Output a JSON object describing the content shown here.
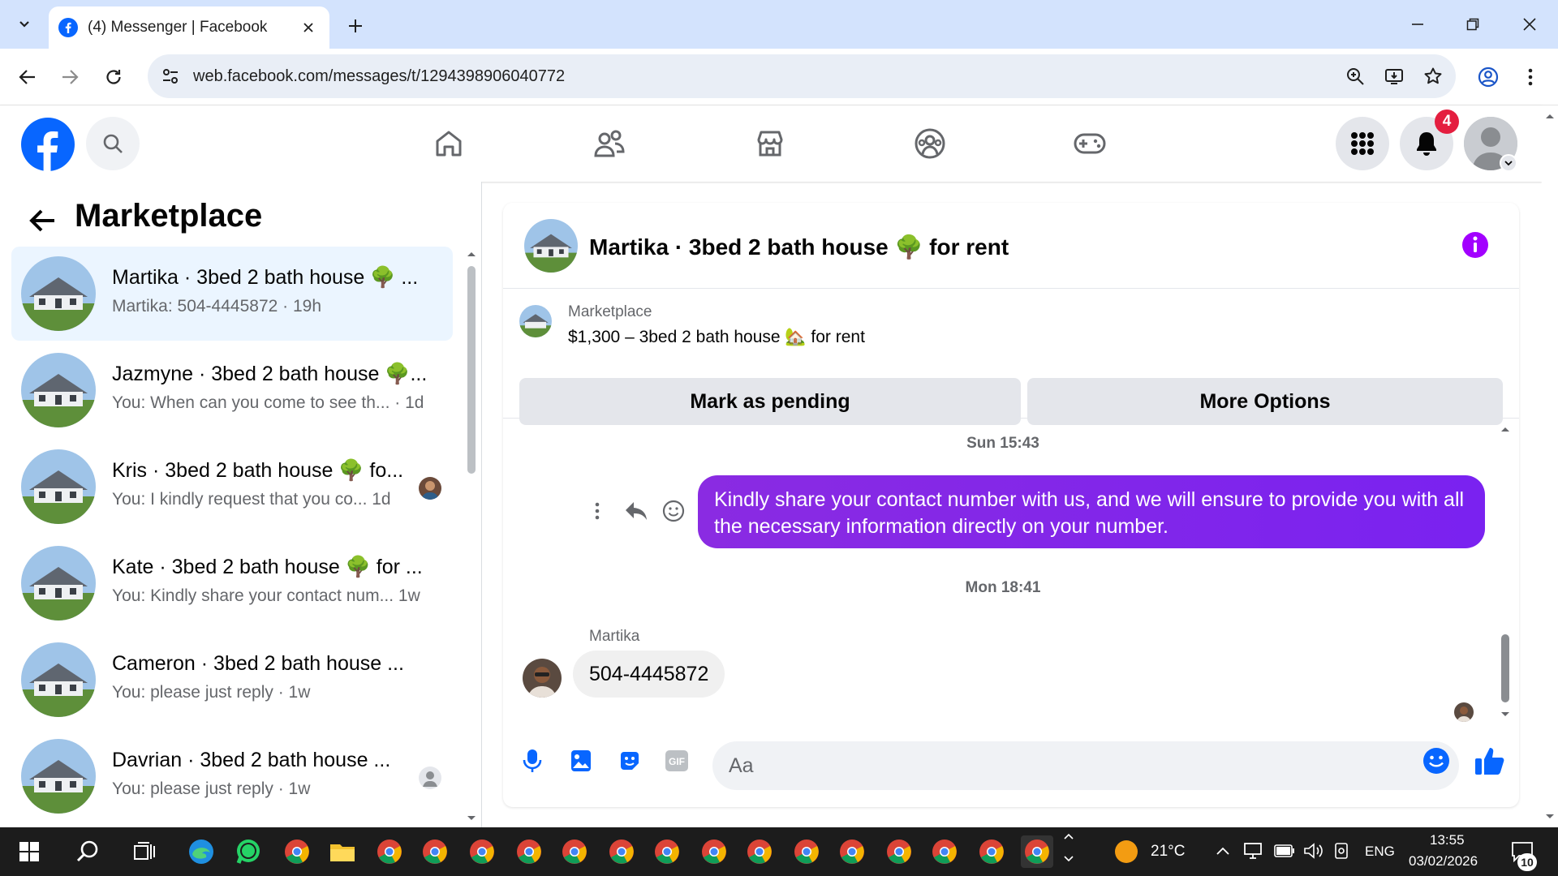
{
  "browser": {
    "tab_title": "(4) Messenger | Facebook",
    "url": "web.facebook.com/messages/t/1294398906040772"
  },
  "facebook": {
    "notification_count": "4"
  },
  "left_panel": {
    "title": "Marketplace",
    "conversations": [
      {
        "name": "Martika · 3bed 2 bath house 🌳 ...",
        "preview": "Martika: 504-4445872 · 19h",
        "active": true
      },
      {
        "name": "Jazmyne · 3bed 2 bath house 🌳...",
        "preview": "You: When can you come to see th...  · 1d"
      },
      {
        "name": "Kris · 3bed 2 bath house 🌳 fo...",
        "preview": "You: I kindly request that you co...  1d"
      },
      {
        "name": "Kate · 3bed 2 bath house 🌳 for ...",
        "preview": "You: Kindly share your contact num...  1w"
      },
      {
        "name": "Cameron · 3bed 2 bath house ...",
        "preview": "You: please just reply · 1w"
      },
      {
        "name": "Davrian · 3bed 2 bath house ...",
        "preview": "You: please just reply · 1w"
      }
    ]
  },
  "chat": {
    "title": "Martika · 3bed 2 bath house 🌳 for rent",
    "listing_source": "Marketplace",
    "listing_text": "$1,300 – 3bed 2 bath house 🏡 for rent",
    "mark_pending_label": "Mark as pending",
    "more_options_label": "More Options",
    "time_1": "Sun 15:43",
    "outgoing_message": "Kindly share your contact number with us, and we will ensure to provide you with all the necessary information directly on your number.",
    "time_2": "Mon 18:41",
    "sender_name": "Martika",
    "incoming_message": "504-4445872",
    "composer_placeholder": "Aa"
  },
  "taskbar": {
    "weather": "21°C",
    "language": "ENG",
    "time": "13:55",
    "date": "03/02/2026",
    "notification_count": "10"
  },
  "colors": {
    "fb_blue": "#0866ff",
    "messenger_purple": "#7a22f0",
    "active_conv_bg": "#ebf5ff"
  },
  "icons": [
    "chevron-down-icon",
    "facebook-icon",
    "close-icon",
    "plus-icon",
    "minimize-icon",
    "restore-icon",
    "back-arrow-icon",
    "forward-arrow-icon",
    "reload-icon",
    "site-settings-icon",
    "zoom-icon",
    "install-icon",
    "star-icon",
    "profile-icon",
    "kebab-icon",
    "search-icon",
    "home-icon",
    "friends-icon",
    "marketplace-icon",
    "groups-icon",
    "gaming-icon",
    "menu-grid-icon",
    "bell-icon",
    "avatar-icon",
    "info-icon",
    "more-vertical-icon",
    "reply-icon",
    "smiley-icon",
    "mic-icon",
    "image-icon",
    "sticker-icon",
    "gif-icon",
    "emoji-icon",
    "thumbs-up-icon",
    "windows-icon",
    "taskview-icon",
    "edge-icon",
    "whatsapp-icon",
    "chrome-icon",
    "file-explorer-icon",
    "sun-icon",
    "wifi-icon",
    "battery-icon",
    "volume-icon"
  ]
}
